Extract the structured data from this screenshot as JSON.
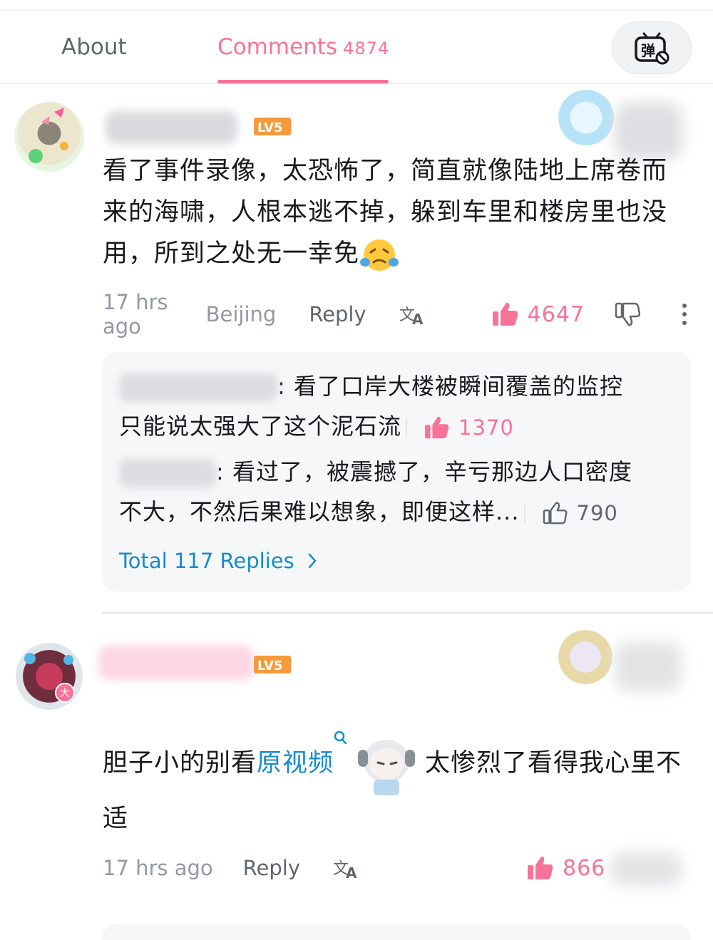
{
  "tabs": {
    "about": "About",
    "comments": "Comments",
    "comments_count": "4874",
    "danmaku_icon": "danmaku-off-icon"
  },
  "colors": {
    "accent": "#fb7299",
    "link": "#178bcf",
    "muted": "#9499a0",
    "text": "#18191c"
  },
  "comments": [
    {
      "level": "LV5",
      "text": "看了事件录像，太恐怖了，简直就像陆地上席卷而来的海啸，人根本逃不掉，躲到车里和楼房里也没用，所到之处无一幸免",
      "emoji": "crying-face-icon",
      "time": "17 hrs ago",
      "location": "Beijing",
      "reply_label": "Reply",
      "likes": "4647",
      "replies": [
        {
          "text_line1": ": 看了口岸大楼被瞬间覆盖的监控",
          "text_line2": "只能说太强大了这个泥石流",
          "likes": "1370",
          "liked": true
        },
        {
          "text_line1": ": 看过了，被震撼了，辛亏那边人口密度",
          "text_line2": "不大，不然后果难以想象，即便这样...",
          "likes": "790",
          "liked": false
        }
      ],
      "total_replies": "Total 117 Replies"
    },
    {
      "level": "LV5",
      "text_part1": "胆子小的别看",
      "link_text": "原视频",
      "text_part2": "太惨烈了看得我心里不适",
      "time": "17 hrs ago",
      "reply_label": "Reply",
      "likes": "866"
    }
  ]
}
